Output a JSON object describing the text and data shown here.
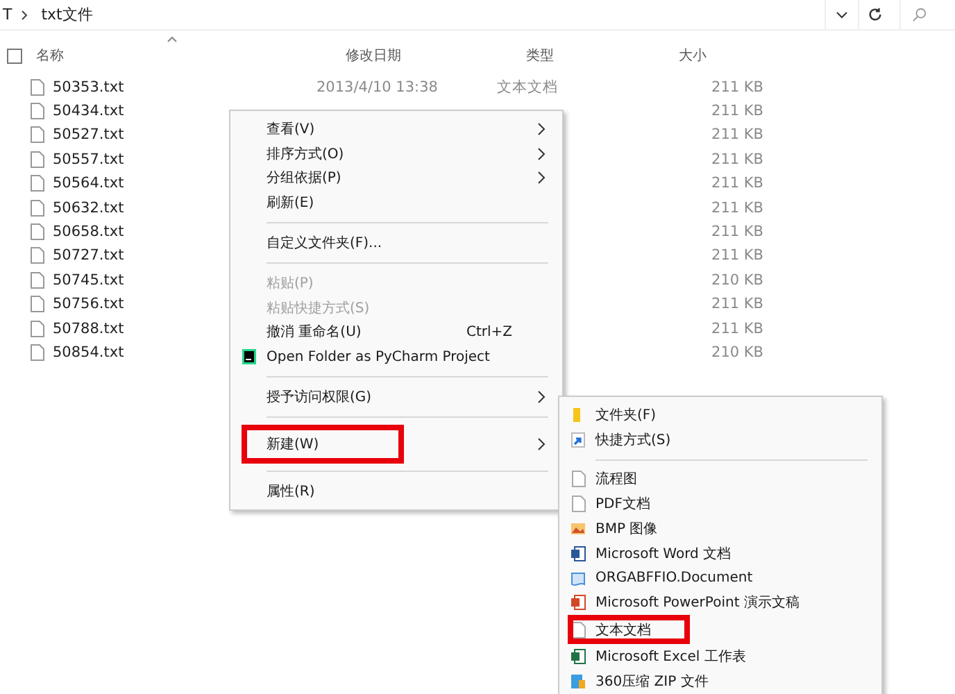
{
  "address_bar": {
    "path": [
      "T",
      "txt文件"
    ]
  },
  "select_all": {
    "checked": false
  },
  "columns": [
    "名称",
    "修改日期",
    "类型",
    "大小"
  ],
  "rows": [
    {
      "name": "50353.txt",
      "date": "2013/4/10 13:38",
      "type": "文本文档",
      "size": "211 KB"
    },
    {
      "name": "50434.txt",
      "size": "211 KB"
    },
    {
      "name": "50527.txt",
      "size": "211 KB"
    },
    {
      "name": "50557.txt",
      "size": "211 KB"
    },
    {
      "name": "50564.txt",
      "size": "211 KB"
    },
    {
      "name": "50632.txt",
      "size": "211 KB"
    },
    {
      "name": "50658.txt",
      "size": "211 KB"
    },
    {
      "name": "50727.txt",
      "size": "211 KB"
    },
    {
      "name": "50745.txt",
      "size": "210 KB"
    },
    {
      "name": "50756.txt",
      "size": "211 KB"
    },
    {
      "name": "50788.txt",
      "size": "211 KB"
    },
    {
      "name": "50854.txt",
      "size": "210 KB"
    }
  ],
  "context_menu": [
    {
      "kind": "item",
      "label": "查看(V)",
      "submenu": true,
      "disabled": false,
      "highlighted": false
    },
    {
      "kind": "item",
      "label": "排序方式(O)",
      "submenu": true,
      "disabled": false,
      "highlighted": false
    },
    {
      "kind": "item",
      "label": "分组依据(P)",
      "submenu": true,
      "disabled": false,
      "highlighted": false
    },
    {
      "kind": "item",
      "label": "刷新(E)",
      "submenu": false,
      "disabled": false,
      "highlighted": false
    },
    {
      "kind": "separator"
    },
    {
      "kind": "item",
      "label": "自定义文件夹(F)...",
      "submenu": false,
      "disabled": false,
      "highlighted": false
    },
    {
      "kind": "separator"
    },
    {
      "kind": "item",
      "label": "粘贴(P)",
      "submenu": false,
      "disabled": true,
      "highlighted": false
    },
    {
      "kind": "item",
      "label": "粘贴快捷方式(S)",
      "submenu": false,
      "disabled": true,
      "highlighted": false
    },
    {
      "kind": "item",
      "label": "撤消 重命名(U)",
      "shortcut": "Ctrl+Z",
      "submenu": false,
      "disabled": false,
      "highlighted": false
    },
    {
      "kind": "item",
      "label": "Open Folder as PyCharm Project",
      "submenu": false,
      "disabled": false,
      "highlighted": false
    },
    {
      "kind": "separator"
    },
    {
      "kind": "item",
      "label": "授予访问权限(G)",
      "submenu": true,
      "disabled": false,
      "highlighted": false
    },
    {
      "kind": "separator"
    },
    {
      "kind": "item",
      "label": "新建(W)",
      "submenu": true,
      "disabled": false,
      "highlighted": true
    },
    {
      "kind": "separator"
    },
    {
      "kind": "item",
      "label": "属性(R)",
      "submenu": false,
      "disabled": false,
      "highlighted": false
    }
  ],
  "new_submenu": [
    {
      "kind": "item",
      "label": "文件夹(F)",
      "highlighted": false
    },
    {
      "kind": "item",
      "label": "快捷方式(S)",
      "highlighted": false
    },
    {
      "kind": "separator"
    },
    {
      "kind": "item",
      "label": "流程图",
      "highlighted": false
    },
    {
      "kind": "item",
      "label": "PDF文档",
      "highlighted": false
    },
    {
      "kind": "item",
      "label": "BMP 图像",
      "highlighted": false
    },
    {
      "kind": "item",
      "label": "Microsoft Word 文档",
      "highlighted": false
    },
    {
      "kind": "item",
      "label": "ORGABFFIO.Document",
      "highlighted": false
    },
    {
      "kind": "item",
      "label": "Microsoft PowerPoint 演示文稿",
      "highlighted": false
    },
    {
      "kind": "item",
      "label": "文本文档",
      "highlighted": true
    },
    {
      "kind": "item",
      "label": "Microsoft Excel 工作表",
      "highlighted": false
    },
    {
      "kind": "item",
      "label": "360压缩 ZIP 文件",
      "highlighted": false
    }
  ]
}
